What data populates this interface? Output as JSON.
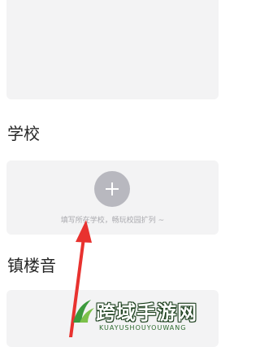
{
  "sections": {
    "school_title": "学校",
    "school_hint": "填写所在学校，畅玩校园扩列 ~",
    "tower_title": "镇楼音"
  },
  "watermark": {
    "title": "跨域手游网",
    "subtitle": "KUAYUSHOUYOUWANG"
  },
  "colors": {
    "card_bg": "#f3f3f4",
    "add_button": "#b8b8bf",
    "arrow": "#e8322f"
  },
  "icons": [
    "plus-icon",
    "red-arrow-annotation",
    "watermark-logo"
  ]
}
